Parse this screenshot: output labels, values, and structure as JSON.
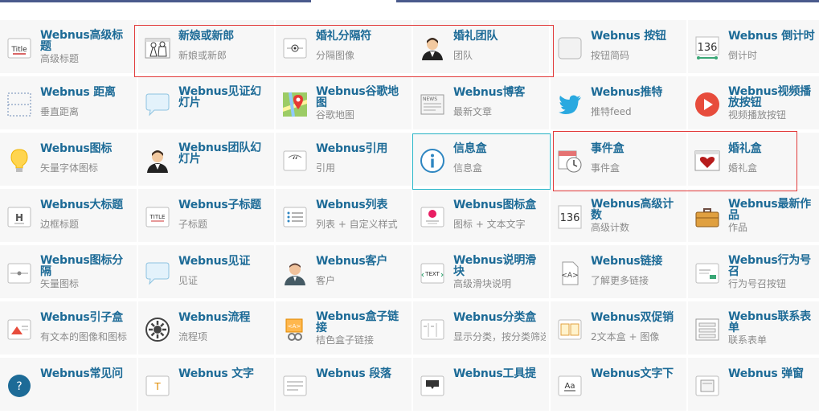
{
  "colors": {
    "title": "#1d6b97",
    "subtitle": "#8b8b8b",
    "cell_bg": "#f7f7f7",
    "highlight_red": "#e23b3b",
    "highlight_cyan": "#29b6c9"
  },
  "rows": [
    [
      {
        "title": "Webnus高级标题",
        "sub": "高级标题",
        "icon": "title-text-icon"
      },
      {
        "title": "新娘或新郎",
        "sub": "新娘或新郎",
        "icon": "bride-groom-icon"
      },
      {
        "title": "婚礼分隔符",
        "sub": "分隔图像",
        "icon": "separator-icon"
      },
      {
        "title": "婚礼团队",
        "sub": "团队",
        "icon": "person-avatar-icon"
      },
      {
        "title": "Webnus 按钮",
        "sub": "按钮简码",
        "icon": "button-icon"
      },
      {
        "title": "Webnus 倒计时",
        "sub": "倒计时",
        "icon": "countdown-136-icon"
      }
    ],
    [
      {
        "title": "Webnus 距离",
        "sub": "垂直距离",
        "icon": "distance-icon"
      },
      {
        "title": "Webnus见证幻灯片",
        "sub": "",
        "icon": "speech-bubble-icon"
      },
      {
        "title": "Webnus谷歌地图",
        "sub": "谷歌地图",
        "icon": "google-map-icon"
      },
      {
        "title": "Webnus博客",
        "sub": "最新文章",
        "icon": "news-icon"
      },
      {
        "title": "Webnus推特",
        "sub": "推特feed",
        "icon": "twitter-bird-icon"
      },
      {
        "title": "Webnus视频播放按钮",
        "sub": "视频播放按钮",
        "icon": "play-button-icon"
      }
    ],
    [
      {
        "title": "Webnus图标",
        "sub": "矢量字体图标",
        "icon": "lightbulb-icon"
      },
      {
        "title": "Webnus团队幻灯片",
        "sub": "",
        "icon": "person-avatar-icon"
      },
      {
        "title": "Webnus引用",
        "sub": "引用",
        "icon": "quote-icon"
      },
      {
        "title": "信息盒",
        "sub": "信息盒",
        "icon": "info-icon"
      },
      {
        "title": "事件盒",
        "sub": "事件盒",
        "icon": "calendar-clock-icon"
      },
      {
        "title": "婚礼盒",
        "sub": "婚礼盒",
        "icon": "heart-window-icon"
      }
    ],
    [
      {
        "title": "Webnus大标题",
        "sub": "边框标题",
        "icon": "heading-h-icon"
      },
      {
        "title": "Webnus子标题",
        "sub": "子标题",
        "icon": "subtitle-icon"
      },
      {
        "title": "Webnus列表",
        "sub": "列表 + 自定义样式",
        "icon": "list-icon"
      },
      {
        "title": "Webnus图标盒",
        "sub": "图标 + 文本文字",
        "icon": "icon-box-icon"
      },
      {
        "title": "Webnus高级计数",
        "sub": "高级计数",
        "icon": "counter-136-icon"
      },
      {
        "title": "Webnus最新作品",
        "sub": "作品",
        "icon": "briefcase-icon"
      }
    ],
    [
      {
        "title": "Webnus图标分隔",
        "sub": "矢量图标",
        "icon": "icon-separator-icon"
      },
      {
        "title": "Webnus见证",
        "sub": "见证",
        "icon": "speech-bubble-icon"
      },
      {
        "title": "Webnus客户",
        "sub": "客户",
        "icon": "client-person-icon"
      },
      {
        "title": "Webnus说明滑块",
        "sub": "高级滑块说明",
        "icon": "text-slider-icon"
      },
      {
        "title": "Webnus链接",
        "sub": "了解更多链接",
        "icon": "link-code-icon"
      },
      {
        "title": "Webnus行为号召",
        "sub": "行为号召按钮",
        "icon": "call-to-action-icon"
      }
    ],
    [
      {
        "title": "Webnus引子盒",
        "sub": "有文本的图像和图标",
        "icon": "teaser-box-icon"
      },
      {
        "title": "Webnus流程",
        "sub": "流程项",
        "icon": "process-gear-icon"
      },
      {
        "title": "Webnus盒子链接",
        "sub": "桔色盒子链接",
        "icon": "box-link-icon"
      },
      {
        "title": "Webnus分类盒",
        "sub": "显示分类，按分类筛选",
        "icon": "category-box-icon"
      },
      {
        "title": "Webnus双促销",
        "sub": "2文本盒 + 图像",
        "icon": "double-promo-icon"
      },
      {
        "title": "Webnus联系表单",
        "sub": "联系表单",
        "icon": "contact-form-icon"
      }
    ],
    [
      {
        "title": "Webnus常见问",
        "sub": "",
        "icon": "faq-icon"
      },
      {
        "title": "Webnus 文字",
        "sub": "",
        "icon": "text-icon"
      },
      {
        "title": "Webnus 段落",
        "sub": "",
        "icon": "paragraph-icon"
      },
      {
        "title": "Webnus工具提",
        "sub": "",
        "icon": "tooltip-icon"
      },
      {
        "title": "Webnus文字下",
        "sub": "",
        "icon": "text-underline-icon"
      },
      {
        "title": "Webnus 弹窗",
        "sub": "",
        "icon": "popup-icon"
      }
    ]
  ]
}
